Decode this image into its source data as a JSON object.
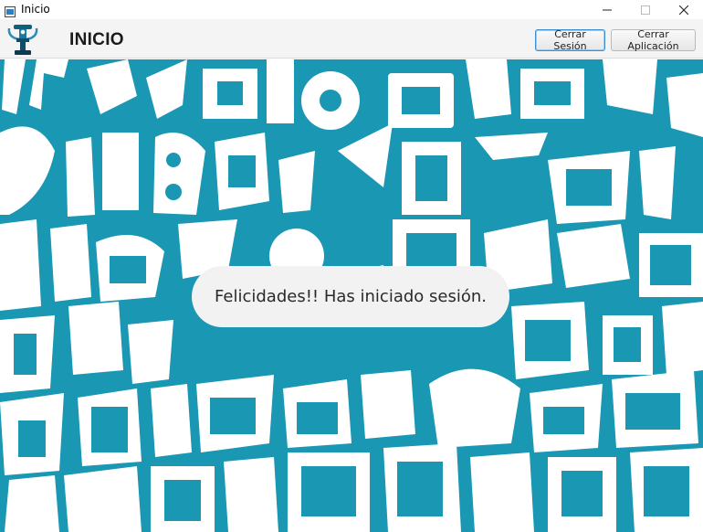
{
  "window": {
    "title": "Inicio",
    "app_icon": "java-window-icon",
    "controls": [
      "minimize-icon",
      "maximize-icon",
      "close-icon"
    ]
  },
  "header": {
    "logo": "dumbbell-hand-logo",
    "title": "INICIO",
    "logout_label": "Cerrar Sesión",
    "exit_label": "Cerrar Aplicación"
  },
  "main": {
    "background": "teal-white-abstract-pattern",
    "message": "Felicidades!! Has iniciado sesión."
  },
  "colors": {
    "pattern_teal": "#1a97b3",
    "pattern_white": "#ffffff",
    "header_bg": "#f4f4f4",
    "message_bg": "#f2f2f2",
    "button_focus": "#3c8fd1"
  }
}
